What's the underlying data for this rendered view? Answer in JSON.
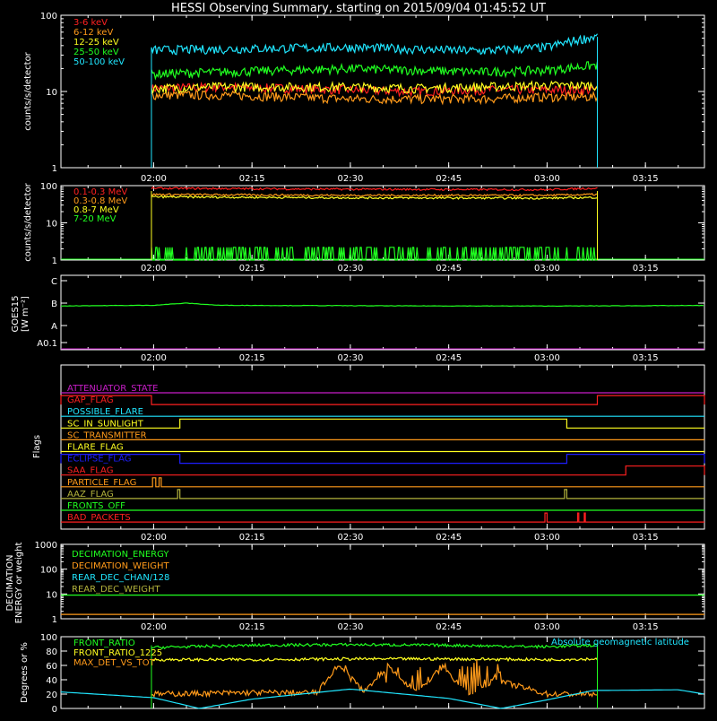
{
  "title": "HESSI Observing Summary, starting on 2015/09/04 01:45:52 UT",
  "time_ticks": [
    "02:00",
    "02:15",
    "02:30",
    "02:45",
    "03:00",
    "03:15"
  ],
  "colors": {
    "background": "#000000",
    "axis": "#ffffff",
    "red": "#ff2020",
    "orange": "#ff9a1a",
    "yellow": "#ffff20",
    "green": "#20ff20",
    "cyan": "#20e6ff",
    "magenta": "#c81ec8",
    "blue": "#1e1eff",
    "olive": "#b4b43c"
  },
  "chart_data": [
    {
      "type": "line",
      "panel": "low-energy-rates",
      "ylabel": "counts/s/detector",
      "yscale": "log",
      "ylim": [
        1,
        100
      ],
      "ytick_labels": [
        "1",
        "10",
        "100"
      ],
      "xlim": [
        "01:45:52",
        "03:24:00"
      ],
      "legend_placement": "top-left",
      "observation_window": [
        "01:59:40",
        "03:07:40"
      ],
      "series": [
        {
          "name": "3-6 keV",
          "color": "#ff2020",
          "x": [
            "02:00",
            "02:10",
            "02:20",
            "02:30",
            "02:40",
            "02:50",
            "03:00",
            "03:07"
          ],
          "values": [
            11,
            11.5,
            11,
            10.5,
            10,
            10.5,
            10.5,
            10.5
          ]
        },
        {
          "name": "6-12 keV",
          "color": "#ff9a1a",
          "x": [
            "02:00",
            "02:10",
            "02:20",
            "02:30",
            "02:40",
            "02:50",
            "03:00",
            "03:07"
          ],
          "values": [
            9,
            9,
            8.5,
            8,
            8,
            8,
            8.5,
            8.5
          ]
        },
        {
          "name": "12-25 keV",
          "color": "#ffff20",
          "x": [
            "02:00",
            "02:10",
            "02:20",
            "02:30",
            "02:40",
            "02:50",
            "03:00",
            "03:07"
          ],
          "values": [
            11,
            11.5,
            11.5,
            11.5,
            11,
            11.5,
            12,
            12
          ]
        },
        {
          "name": "25-50 keV",
          "color": "#20ff20",
          "x": [
            "02:00",
            "02:10",
            "02:20",
            "02:30",
            "02:40",
            "02:50",
            "03:00",
            "03:07"
          ],
          "values": [
            17,
            18,
            19,
            20,
            19,
            18,
            19,
            22
          ]
        },
        {
          "name": "50-100 keV",
          "color": "#20e6ff",
          "x": [
            "02:00",
            "02:10",
            "02:20",
            "02:30",
            "02:40",
            "02:50",
            "03:00",
            "03:07"
          ],
          "values": [
            35,
            36,
            37,
            38,
            36,
            34,
            38,
            52
          ]
        }
      ]
    },
    {
      "type": "line",
      "panel": "high-energy-rates",
      "ylabel": "counts/s/detector",
      "yscale": "log",
      "ylim": [
        1,
        100
      ],
      "ytick_labels": [
        "1",
        "10",
        "100"
      ],
      "legend_placement": "top-left",
      "series": [
        {
          "name": "0.1-0.3 MeV",
          "color": "#ff2020",
          "x": [
            "02:00",
            "02:30",
            "03:00",
            "03:07"
          ],
          "values": [
            85,
            80,
            78,
            85
          ]
        },
        {
          "name": "0.3-0.8 MeV",
          "color": "#ff9a1a",
          "x": [
            "02:00",
            "02:30",
            "03:00",
            "03:07"
          ],
          "values": [
            58,
            55,
            55,
            58
          ]
        },
        {
          "name": "0.8-7 MeV",
          "color": "#ffff20",
          "x": [
            "02:00",
            "02:30",
            "03:00",
            "03:07"
          ],
          "values": [
            50,
            47,
            46,
            48
          ]
        },
        {
          "name": "7-20 MeV",
          "color": "#20ff20",
          "x": [
            "02:00",
            "02:30",
            "03:00",
            "03:07"
          ],
          "values": [
            1.3,
            1.6,
            1.6,
            1.5
          ]
        }
      ]
    },
    {
      "type": "line",
      "panel": "goes-flux",
      "ylabel": "GOES15 [W m⁻²]",
      "ytick_labels": [
        "A0.1",
        "A",
        "B",
        "C"
      ],
      "series": [
        {
          "color": "#20ff20",
          "x": [
            "01:45:52",
            "02:00",
            "02:05",
            "02:10",
            "02:20",
            "02:40",
            "03:00",
            "03:24"
          ],
          "values": [
            "B0.75",
            "B0.8",
            "B1.0",
            "B0.8",
            "B0.78",
            "B0.75",
            "B0.74",
            "B0.78"
          ]
        }
      ]
    },
    {
      "type": "table",
      "panel": "flags",
      "ylabel": "Flags",
      "flags": [
        {
          "name": "ATTENUATOR_STATE",
          "color": "#c81ec8",
          "high_intervals": []
        },
        {
          "name": "GAP_FLAG",
          "color": "#ff2020",
          "high_intervals": [
            [
              "01:45:52",
              "01:59:40"
            ],
            [
              "03:07:40",
              "03:24:00"
            ]
          ]
        },
        {
          "name": "POSSIBLE_FLARE",
          "color": "#20e6ff",
          "high_intervals": []
        },
        {
          "name": "SC_IN_SUNLIGHT",
          "color": "#ffff20",
          "high_intervals": [
            [
              "02:04:00",
              "03:03:00"
            ]
          ]
        },
        {
          "name": "SC_TRANSMITTER",
          "color": "#ff9a1a",
          "high_intervals": []
        },
        {
          "name": "FLARE_FLAG",
          "color": "#ffff20",
          "high_intervals": []
        },
        {
          "name": "ECLIPSE_FLAG",
          "color": "#1e1eff",
          "high_intervals": [
            [
              "01:45:52",
              "02:04:00"
            ],
            [
              "03:03:00",
              "03:24:00"
            ]
          ]
        },
        {
          "name": "SAA_FLAG",
          "color": "#ff2020",
          "high_intervals": [
            [
              "03:12:00",
              "03:24:00"
            ]
          ]
        },
        {
          "name": "PARTICLE_FLAG",
          "color": "#ff9a1a",
          "high_intervals": [
            [
              "01:59:50",
              "02:00:20"
            ],
            [
              "02:00:50",
              "02:01:10"
            ]
          ]
        },
        {
          "name": "AAZ_FLAG",
          "color": "#b4b43c",
          "high_intervals": [
            [
              "02:03:40",
              "02:04:00"
            ],
            [
              "03:02:40",
              "03:03:00"
            ]
          ]
        },
        {
          "name": "FRONTS_OFF",
          "color": "#20ff20",
          "high_intervals": []
        },
        {
          "name": "BAD_PACKETS",
          "color": "#ff2020",
          "high_intervals": [
            [
              "02:59:40",
              "03:00:00"
            ],
            [
              "03:04:40",
              "03:04:50"
            ],
            [
              "03:05:40",
              "03:05:50"
            ]
          ]
        }
      ]
    },
    {
      "type": "line",
      "panel": "decimation",
      "ylabel": "DECIMATION ENERGY or weight",
      "yscale": "log",
      "ylim": [
        1,
        1000
      ],
      "ytick_labels": [
        "1",
        "10",
        "100",
        "1000"
      ],
      "legend_placement": "top-left",
      "series": [
        {
          "name": "DECIMATION_ENERGY",
          "color": "#20ff20",
          "x": [
            "01:45:52",
            "03:24:00"
          ],
          "values": [
            9,
            9
          ]
        },
        {
          "name": "DECIMATION_WEIGHT",
          "color": "#ff9a1a",
          "x": [
            "01:45:52",
            "03:24:00"
          ],
          "values": [
            1.5,
            1.5
          ]
        },
        {
          "name": "REAR_DEC_CHAN/128",
          "color": "#20e6ff",
          "x": [],
          "values": []
        },
        {
          "name": "REAR_DEC_WEIGHT",
          "color": "#b4b43c",
          "x": [],
          "values": []
        }
      ]
    },
    {
      "type": "line",
      "panel": "ratios",
      "ylabel": "Degrees or %",
      "ylim": [
        0,
        100
      ],
      "ytick_labels": [
        "0",
        "20",
        "40",
        "60",
        "80",
        "100"
      ],
      "legend_placement": "top-left",
      "annotation": "Absolute geomagnetic latitude",
      "series": [
        {
          "name": "FRONT_RATIO",
          "color": "#20ff20",
          "x": [
            "02:00",
            "02:15",
            "02:30",
            "02:45",
            "03:00",
            "03:07"
          ],
          "values": [
            85,
            88,
            89,
            88,
            86,
            88
          ]
        },
        {
          "name": "FRONT_RATIO_1225",
          "color": "#ffff20",
          "x": [
            "02:00",
            "02:15",
            "02:30",
            "02:45",
            "03:00",
            "03:07"
          ],
          "values": [
            68,
            68,
            69,
            69,
            68,
            69
          ]
        },
        {
          "name": "MAX_DET_VS_TOT",
          "color": "#ff9a1a",
          "x": [
            "02:00",
            "02:15",
            "02:25",
            "02:28",
            "02:32",
            "02:36",
            "02:40",
            "02:44",
            "02:48",
            "02:52",
            "03:00",
            "03:07"
          ],
          "values": [
            20,
            22,
            22,
            60,
            25,
            58,
            22,
            57,
            20,
            40,
            20,
            20
          ]
        },
        {
          "name": "Absolute geomagnetic latitude",
          "color": "#20e6ff",
          "x": [
            "01:45:52",
            "02:00",
            "02:07",
            "02:15",
            "02:30",
            "02:45",
            "02:53",
            "03:00",
            "03:07",
            "03:20",
            "03:24"
          ],
          "values": [
            23,
            15,
            0,
            13,
            27,
            14,
            0,
            12,
            25,
            26,
            20
          ]
        }
      ]
    }
  ]
}
